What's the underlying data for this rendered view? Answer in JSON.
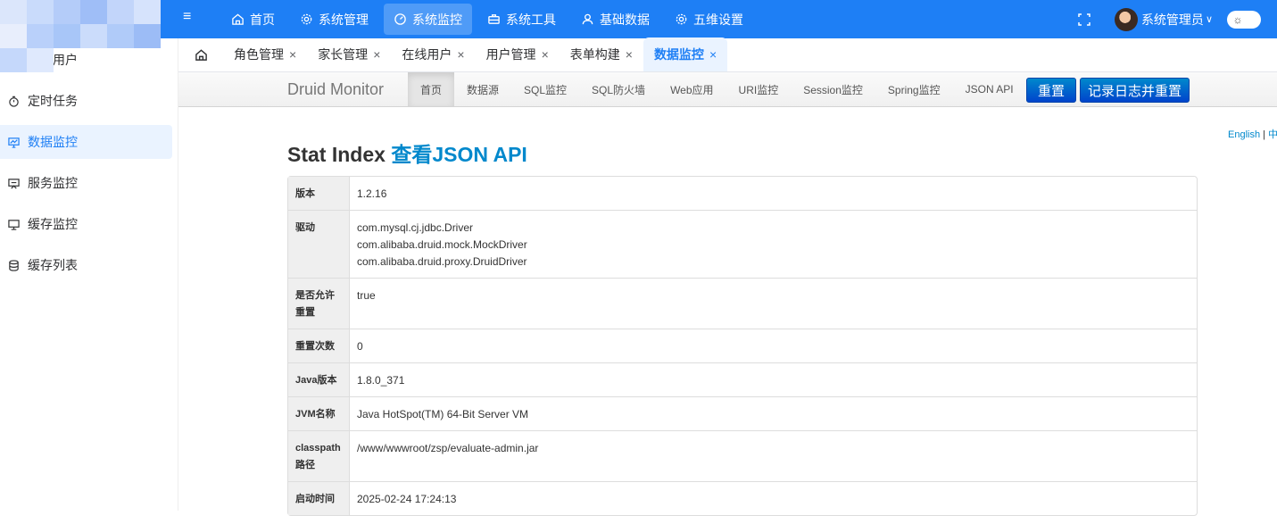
{
  "header": {
    "menu_icon": "hamburger-icon",
    "nav": [
      {
        "label": "首页",
        "icon": "home-icon"
      },
      {
        "label": "系统管理",
        "icon": "gear-icon"
      },
      {
        "label": "系统监控",
        "icon": "gauge-icon",
        "active": true
      },
      {
        "label": "系统工具",
        "icon": "toolbox-icon"
      },
      {
        "label": "基础数据",
        "icon": "user-icon"
      },
      {
        "label": "五维设置",
        "icon": "gear-icon"
      }
    ],
    "user_name": "系统管理员",
    "user_caret": "∨",
    "theme_icon": "☼"
  },
  "sidebar": {
    "items": [
      {
        "label": "在线用户",
        "icon": "online-user-icon"
      },
      {
        "label": "定时任务",
        "icon": "timer-icon"
      },
      {
        "label": "数据监控",
        "icon": "monitor-icon",
        "active": true
      },
      {
        "label": "服务监控",
        "icon": "server-monitor-icon"
      },
      {
        "label": "缓存监控",
        "icon": "cache-monitor-icon"
      },
      {
        "label": "缓存列表",
        "icon": "database-icon"
      }
    ]
  },
  "tabs": {
    "items": [
      {
        "label": "角色管理"
      },
      {
        "label": "家长管理"
      },
      {
        "label": "在线用户"
      },
      {
        "label": "用户管理"
      },
      {
        "label": "表单构建"
      },
      {
        "label": "数据监控",
        "active": true
      }
    ],
    "close_glyph": "×"
  },
  "druid": {
    "brand": "Druid Monitor",
    "nav": [
      "首页",
      "数据源",
      "SQL监控",
      "SQL防火墙",
      "Web应用",
      "URI监控",
      "Session监控",
      "Spring监控",
      "JSON API"
    ],
    "reset_label": "重置",
    "log_reset_label": "记录日志并重置",
    "lang_en": "English",
    "lang_sep": "|",
    "lang_zh": "中",
    "title_prefix": "Stat Index",
    "title_link": "查看JSON API",
    "stats": [
      {
        "key": "版本",
        "value": [
          "1.2.16"
        ]
      },
      {
        "key": "驱动",
        "value": [
          "com.mysql.cj.jdbc.Driver",
          "com.alibaba.druid.mock.MockDriver",
          "com.alibaba.druid.proxy.DruidDriver"
        ]
      },
      {
        "key": "是否允许重置",
        "value": [
          "true"
        ]
      },
      {
        "key": "重置次数",
        "value": [
          "0"
        ]
      },
      {
        "key": "Java版本",
        "value": [
          "1.8.0_371"
        ]
      },
      {
        "key": "JVM名称",
        "value": [
          "Java HotSpot(TM) 64-Bit Server VM"
        ]
      },
      {
        "key": "classpath路径",
        "value": [
          "/www/wwwroot/zsp/evaluate-admin.jar"
        ]
      },
      {
        "key": "启动时间",
        "value": [
          "2025-02-24 17:24:13"
        ]
      }
    ]
  },
  "colors": {
    "primary": "#1e7ff5",
    "druid_button": "#0065cc",
    "link": "#0088cc"
  }
}
